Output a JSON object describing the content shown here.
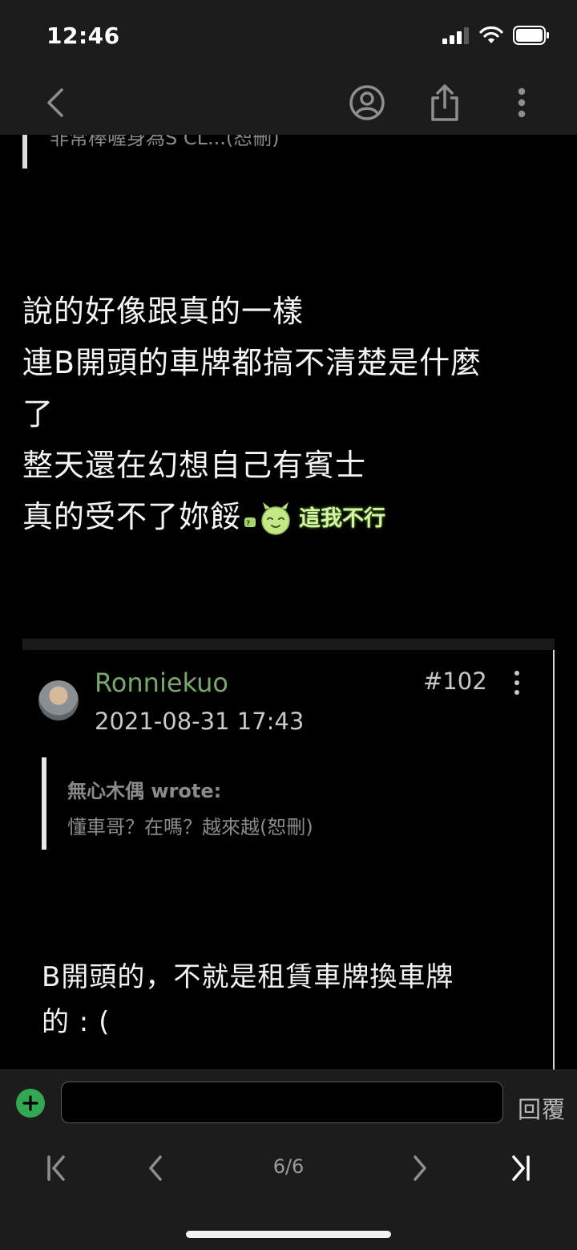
{
  "status_bar": {
    "time": "12:46"
  },
  "prev_quote": {
    "text": "非常棒喔身為S CL...(恕刪)"
  },
  "post": {
    "lines": [
      "說的好像跟真的一樣",
      "連B開頭的車牌都搞不清楚是什麼",
      "了",
      "整天還在幻想自己有賓士"
    ],
    "last_line": "真的受不了妳餒",
    "emote_text": "這我不行"
  },
  "reply": {
    "username": "Ronniekuo",
    "timestamp": "2021-08-31 17:43",
    "floor": "#102",
    "quote_author": "無心木偶 wrote:",
    "quote_text": "懂車哥？在嗎？越來越(恕刪)",
    "body_lines": [
      "B開頭的，不就是租賃車牌換車牌",
      "的 : ("
    ]
  },
  "composer": {
    "reply_label": "回覆",
    "input_value": ""
  },
  "pager": {
    "label": "6/6"
  },
  "colors": {
    "username": "#7aa86c",
    "add_button": "#33a852",
    "background": "#000000",
    "bar": "#1c1c1c"
  },
  "icons": [
    "back-chevron-icon",
    "profile-icon",
    "share-icon",
    "more-icon",
    "add-icon",
    "first-page-icon",
    "prev-page-icon",
    "next-page-icon",
    "last-page-icon"
  ]
}
